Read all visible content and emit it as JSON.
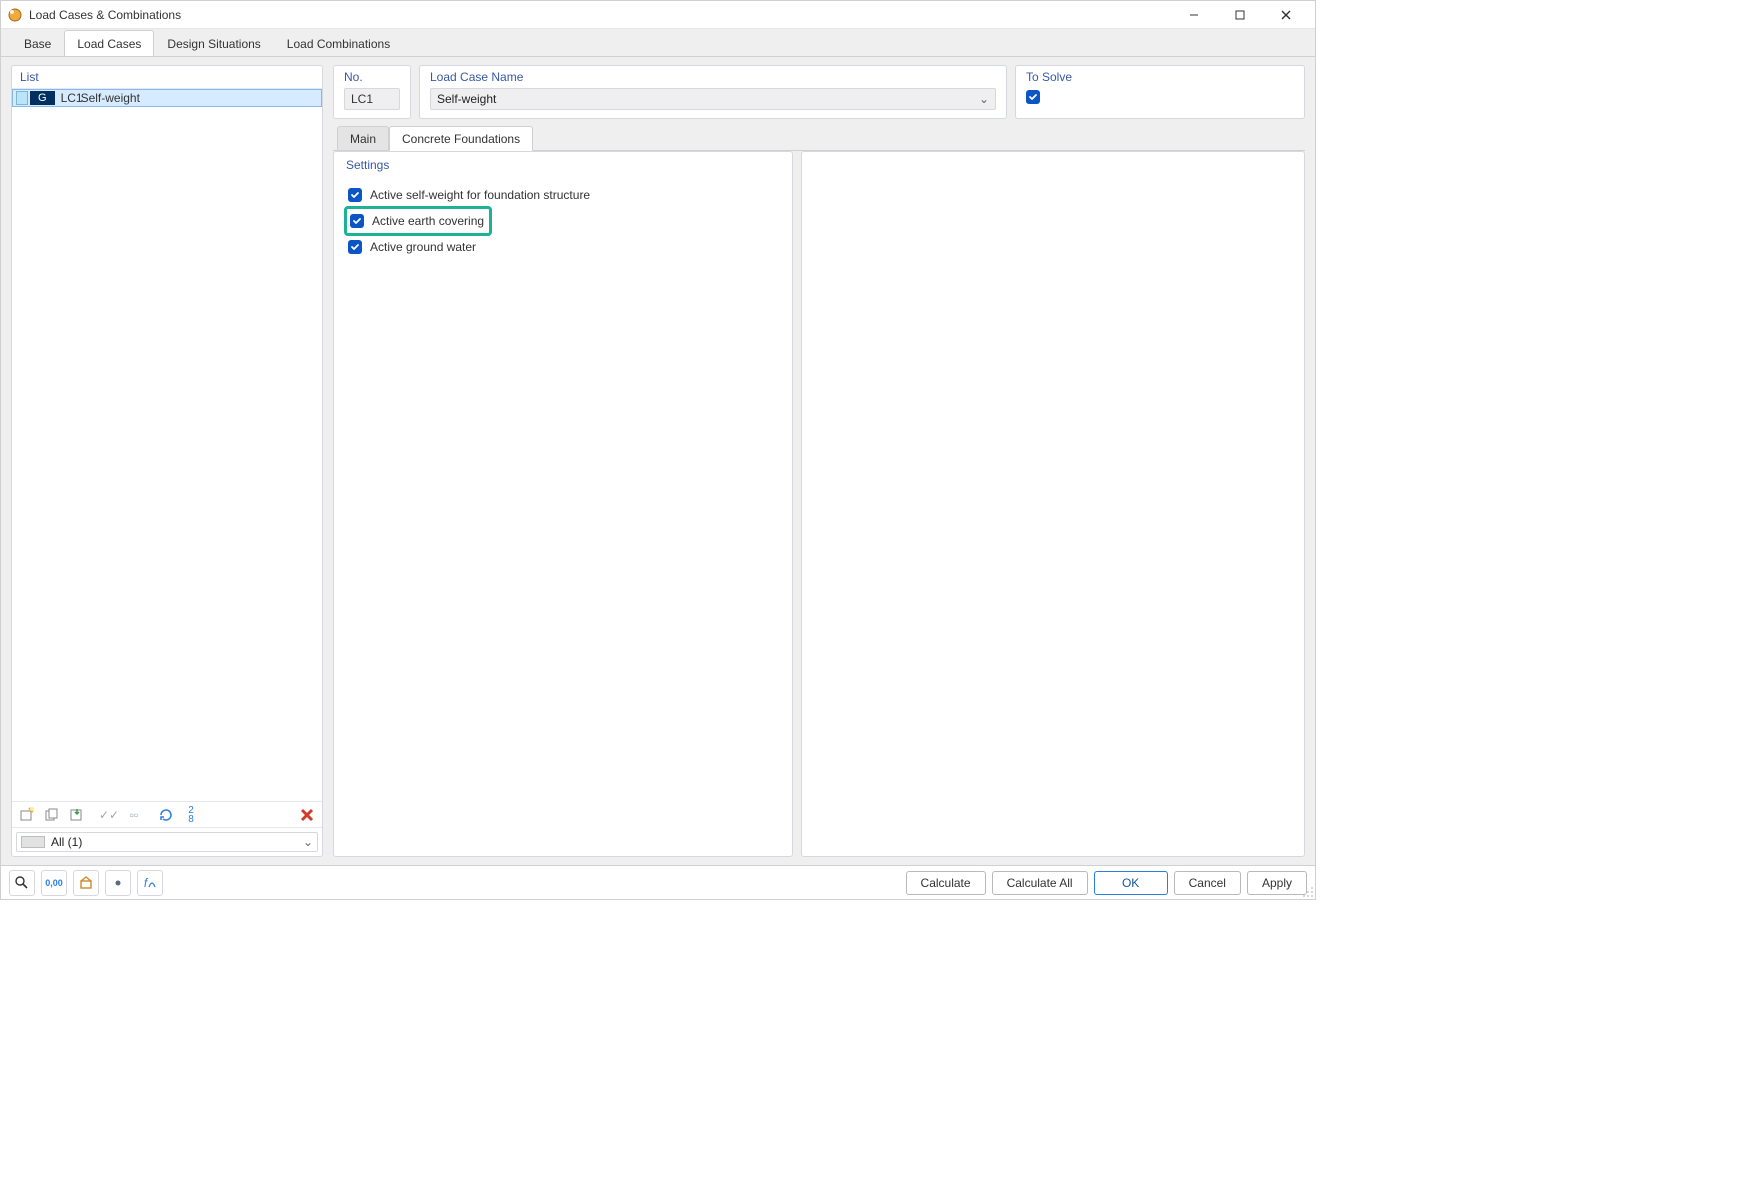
{
  "window_title": "Load Cases & Combinations",
  "tabs": {
    "base": "Base",
    "load_cases": "Load Cases",
    "design_situations": "Design Situations",
    "load_combinations": "Load Combinations"
  },
  "list": {
    "header": "List",
    "items": [
      {
        "tag": "G",
        "id": "LC1",
        "name": "Self-weight"
      }
    ],
    "filter_label": "All (1)"
  },
  "fields": {
    "no_label": "No.",
    "no_value": "LC1",
    "name_label": "Load Case Name",
    "name_value": "Self-weight",
    "solve_label": "To Solve"
  },
  "subtabs": {
    "main": "Main",
    "concrete": "Concrete Foundations"
  },
  "settings": {
    "header": "Settings",
    "opt_self_weight": "Active self-weight for foundation structure",
    "opt_earth": "Active earth covering",
    "opt_water": "Active ground water"
  },
  "footer": {
    "calculate": "Calculate",
    "calculate_all": "Calculate All",
    "ok": "OK",
    "cancel": "Cancel",
    "apply": "Apply"
  }
}
